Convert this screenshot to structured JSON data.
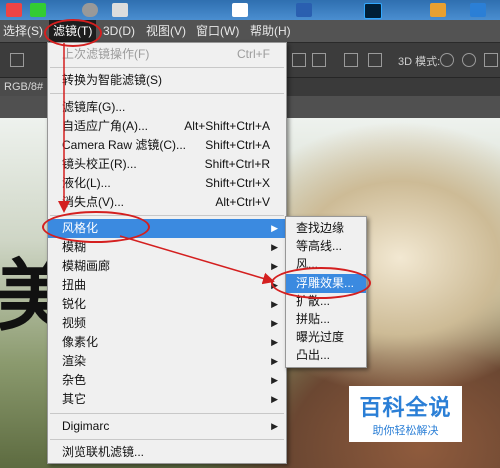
{
  "menubar": {
    "items": [
      {
        "label": "选择(S)"
      },
      {
        "label": "滤镜(T)"
      },
      {
        "label": "3D(D)"
      },
      {
        "label": "视图(V)"
      },
      {
        "label": "窗口(W)"
      },
      {
        "label": "帮助(H)"
      }
    ],
    "active_index": 1
  },
  "options_bar": {
    "mode_label": "3D 模式:"
  },
  "doc_tab": {
    "label": "RGB/8#"
  },
  "canvas_text": "美",
  "filter_menu": {
    "items": [
      {
        "label": "上次滤镜操作(F)",
        "shortcut": "Ctrl+F",
        "disabled": true
      },
      {
        "label": "转换为智能滤镜(S)",
        "shortcut": ""
      },
      {
        "label": "滤镜库(G)...",
        "shortcut": ""
      },
      {
        "label": "自适应广角(A)...",
        "shortcut": "Alt+Shift+Ctrl+A"
      },
      {
        "label": "Camera Raw 滤镜(C)...",
        "shortcut": "Shift+Ctrl+A"
      },
      {
        "label": "镜头校正(R)...",
        "shortcut": "Shift+Ctrl+R"
      },
      {
        "label": "液化(L)...",
        "shortcut": "Shift+Ctrl+X"
      },
      {
        "label": "消失点(V)...",
        "shortcut": "Alt+Ctrl+V"
      },
      {
        "label": "风格化",
        "submenu": true,
        "highlighted": true
      },
      {
        "label": "模糊",
        "submenu": true
      },
      {
        "label": "模糊画廊",
        "submenu": true
      },
      {
        "label": "扭曲",
        "submenu": true
      },
      {
        "label": "锐化",
        "submenu": true
      },
      {
        "label": "视频",
        "submenu": true
      },
      {
        "label": "像素化",
        "submenu": true
      },
      {
        "label": "渲染",
        "submenu": true
      },
      {
        "label": "杂色",
        "submenu": true
      },
      {
        "label": "其它",
        "submenu": true
      },
      {
        "label": "Digimarc",
        "submenu": true
      },
      {
        "label": "浏览联机滤镜..."
      }
    ]
  },
  "stylize_submenu": {
    "items": [
      {
        "label": "查找边缘"
      },
      {
        "label": "等高线..."
      },
      {
        "label": "风..."
      },
      {
        "label": "浮雕效果...",
        "highlighted": true
      },
      {
        "label": "扩散..."
      },
      {
        "label": "拼贴..."
      },
      {
        "label": "曝光过度"
      },
      {
        "label": "凸出..."
      }
    ]
  },
  "watermark": {
    "title": "百科全说",
    "subtitle": "助你轻松解决"
  },
  "colors": {
    "highlight": "#3b8ae0",
    "annotation_red": "#d41f1f",
    "watermark_blue": "#2b7fd6"
  }
}
